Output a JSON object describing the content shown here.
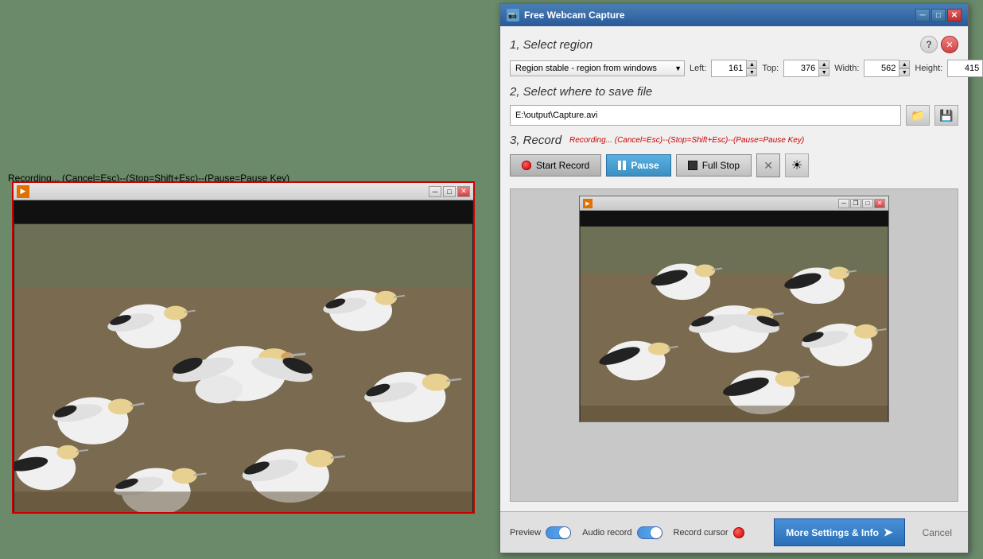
{
  "recording_status": {
    "text": "Recording... (Cancel=Esc)--(Stop=Shift+Esc)--(Pause=Pause Key)"
  },
  "left_window": {
    "title": "",
    "play_icon": "▶",
    "minimize": "─",
    "maximize": "□",
    "close": "✕"
  },
  "dialog": {
    "title": "Free Webcam Capture",
    "section1": {
      "label": "1, Select region",
      "region_option": "Region stable - region from windows",
      "left_label": "Left:",
      "left_value": "161",
      "top_label": "Top:",
      "top_value": "376",
      "width_label": "Width:",
      "width_value": "562",
      "height_label": "Height:",
      "height_value": "415"
    },
    "section2": {
      "label": "2, Select where to save file",
      "file_path": "E:\\output\\Capture.avi"
    },
    "section3": {
      "label": "3, Record",
      "recording_status": "Recording... (Cancel=Esc)--(Stop=Shift+Esc)--(Pause=Pause Key)",
      "start_record": "Start Record",
      "pause": "Pause",
      "full_stop": "Full Stop"
    },
    "bottom": {
      "preview_label": "Preview",
      "audio_record_label": "Audio record",
      "record_cursor_label": "Record cursor",
      "more_settings_label": "More Settings & Info",
      "cancel_label": "Cancel"
    },
    "preview_window": {
      "minimize": "─",
      "maximize": "□",
      "restore": "❐",
      "close": "✕"
    }
  }
}
